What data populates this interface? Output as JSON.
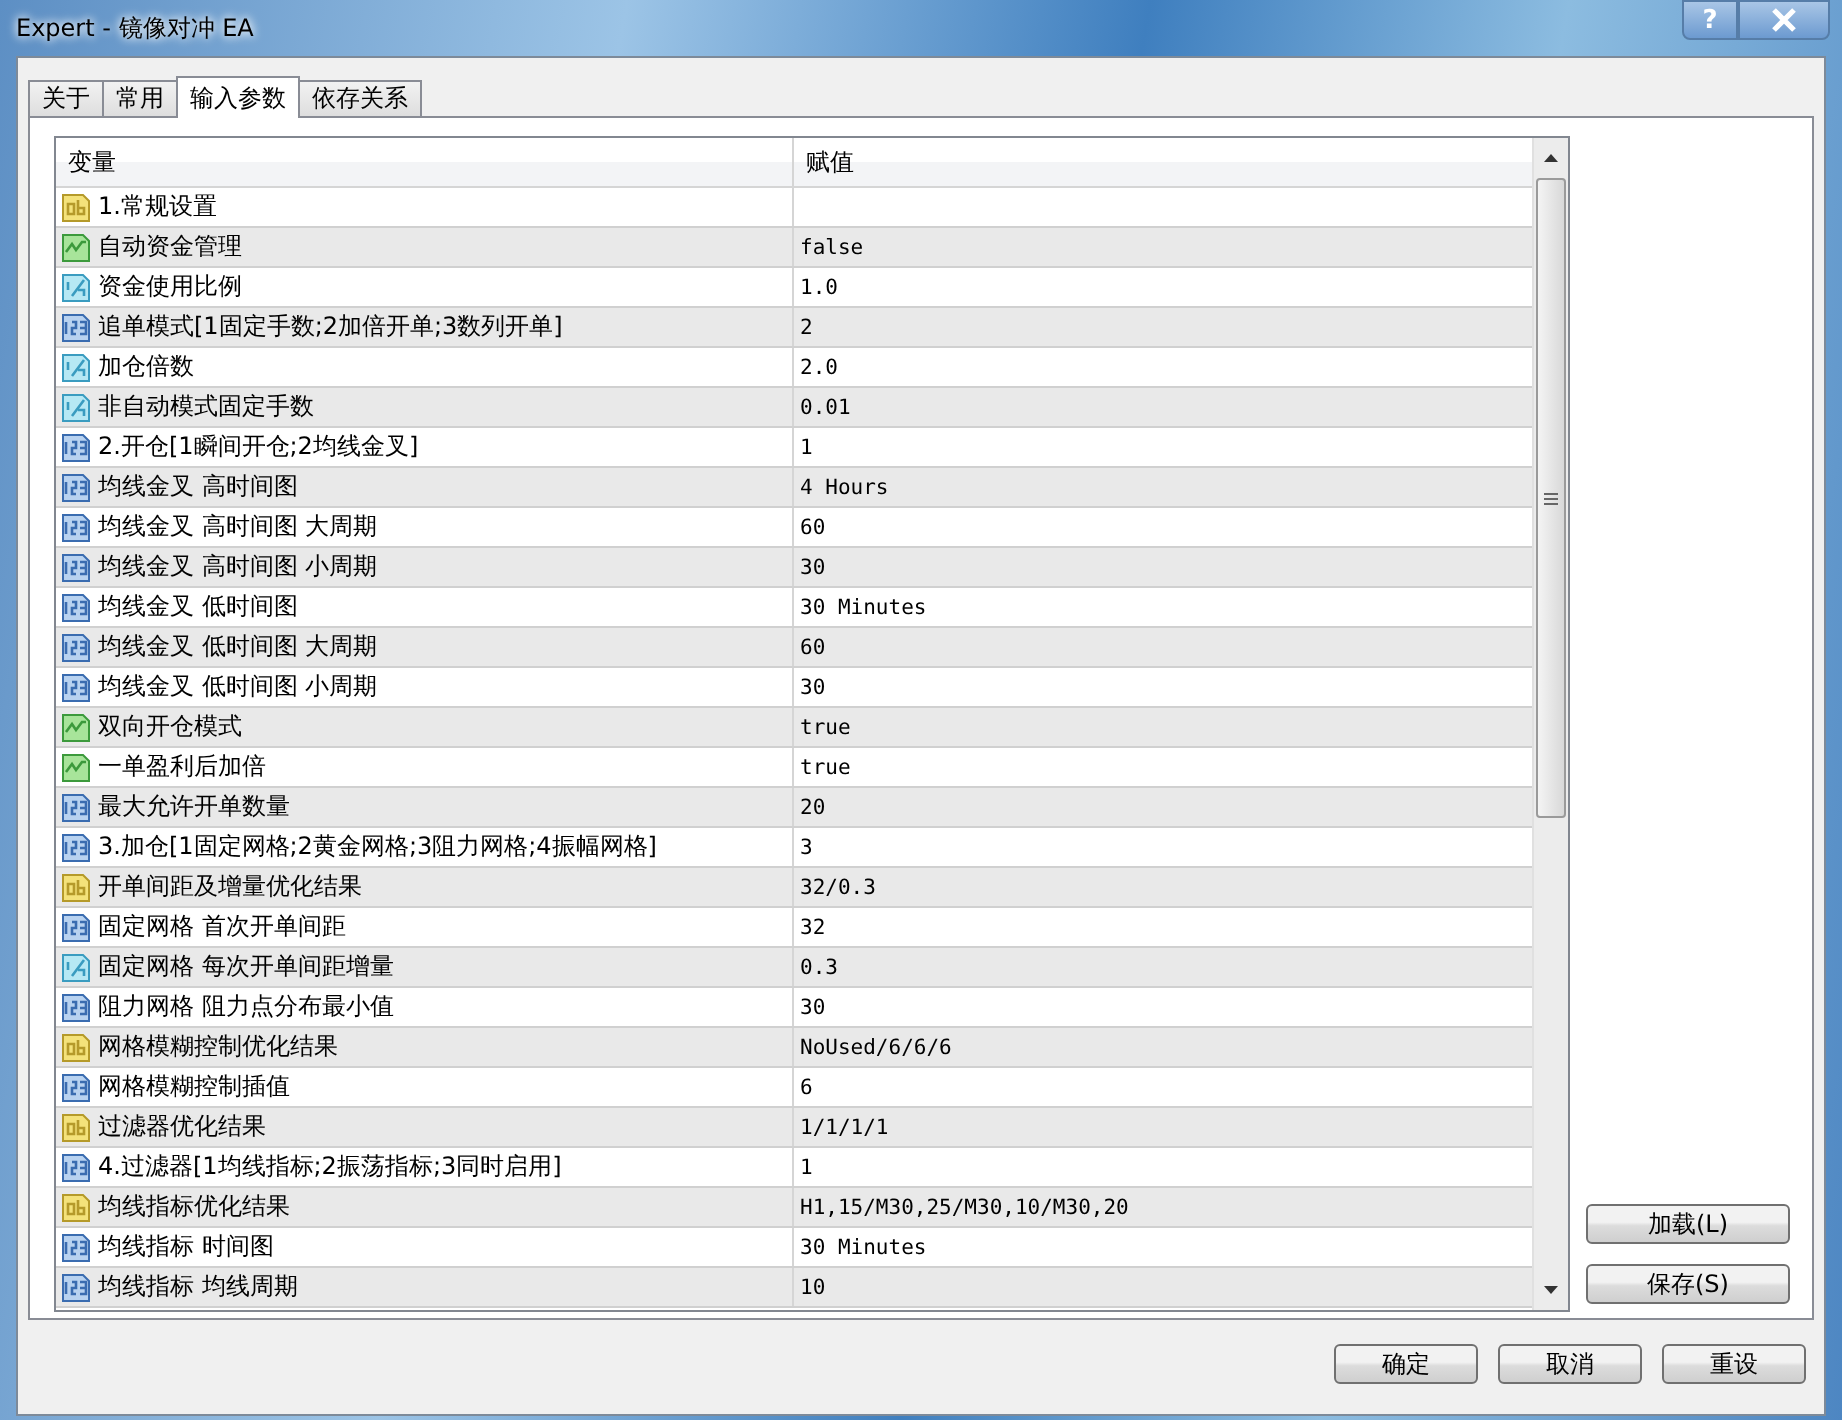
{
  "window": {
    "title": "Expert - 镜像对冲 EA",
    "help_button": "?"
  },
  "tabs": [
    {
      "label": "关于",
      "selected": false
    },
    {
      "label": "常用",
      "selected": false
    },
    {
      "label": "输入参数",
      "selected": true
    },
    {
      "label": "依存关系",
      "selected": false
    }
  ],
  "table": {
    "columns": [
      "变量",
      "赋值"
    ],
    "rows": [
      {
        "kind": "string",
        "name": "1.常规设置",
        "value": ""
      },
      {
        "kind": "bool",
        "name": "自动资金管理",
        "value": "false"
      },
      {
        "kind": "double",
        "name": "资金使用比例",
        "value": "1.0"
      },
      {
        "kind": "int",
        "name": "追单模式[1固定手数;2加倍开单;3数列开单]",
        "value": "2"
      },
      {
        "kind": "double",
        "name": "加仓倍数",
        "value": "2.0"
      },
      {
        "kind": "double",
        "name": "非自动模式固定手数",
        "value": "0.01"
      },
      {
        "kind": "int",
        "name": "2.开仓[1瞬间开仓;2均线金叉]",
        "value": "1"
      },
      {
        "kind": "int",
        "name": "均线金叉 高时间图",
        "value": "4 Hours"
      },
      {
        "kind": "int",
        "name": "均线金叉 高时间图 大周期",
        "value": "60"
      },
      {
        "kind": "int",
        "name": "均线金叉 高时间图 小周期",
        "value": "30"
      },
      {
        "kind": "int",
        "name": "均线金叉 低时间图",
        "value": "30 Minutes"
      },
      {
        "kind": "int",
        "name": "均线金叉 低时间图 大周期",
        "value": "60"
      },
      {
        "kind": "int",
        "name": "均线金叉 低时间图 小周期",
        "value": "30"
      },
      {
        "kind": "bool",
        "name": "双向开仓模式",
        "value": "true"
      },
      {
        "kind": "bool",
        "name": "一单盈利后加倍",
        "value": "true"
      },
      {
        "kind": "int",
        "name": "最大允许开单数量",
        "value": "20"
      },
      {
        "kind": "int",
        "name": "3.加仓[1固定网格;2黄金网格;3阻力网格;4振幅网格]",
        "value": "3"
      },
      {
        "kind": "string",
        "name": "开单间距及增量优化结果",
        "value": "32/0.3"
      },
      {
        "kind": "int",
        "name": "固定网格 首次开单间距",
        "value": "32"
      },
      {
        "kind": "double",
        "name": "固定网格 每次开单间距增量",
        "value": "0.3"
      },
      {
        "kind": "int",
        "name": "阻力网格 阻力点分布最小值",
        "value": "30"
      },
      {
        "kind": "string",
        "name": "网格模糊控制优化结果",
        "value": "NoUsed/6/6/6"
      },
      {
        "kind": "int",
        "name": "网格模糊控制插值",
        "value": "6"
      },
      {
        "kind": "string",
        "name": "过滤器优化结果",
        "value": "1/1/1/1"
      },
      {
        "kind": "int",
        "name": "4.过滤器[1均线指标;2振荡指标;3同时启用]",
        "value": "1"
      },
      {
        "kind": "string",
        "name": "均线指标优化结果",
        "value": "H1,15/M30,25/M30,10/M30,20"
      },
      {
        "kind": "int",
        "name": "均线指标 时间图",
        "value": "30 Minutes"
      },
      {
        "kind": "int",
        "name": "均线指标 均线周期",
        "value": "10"
      }
    ]
  },
  "side_buttons": [
    "加载(L)",
    "保存(S)"
  ],
  "footer_buttons": [
    "确定",
    "取消",
    "重设"
  ]
}
